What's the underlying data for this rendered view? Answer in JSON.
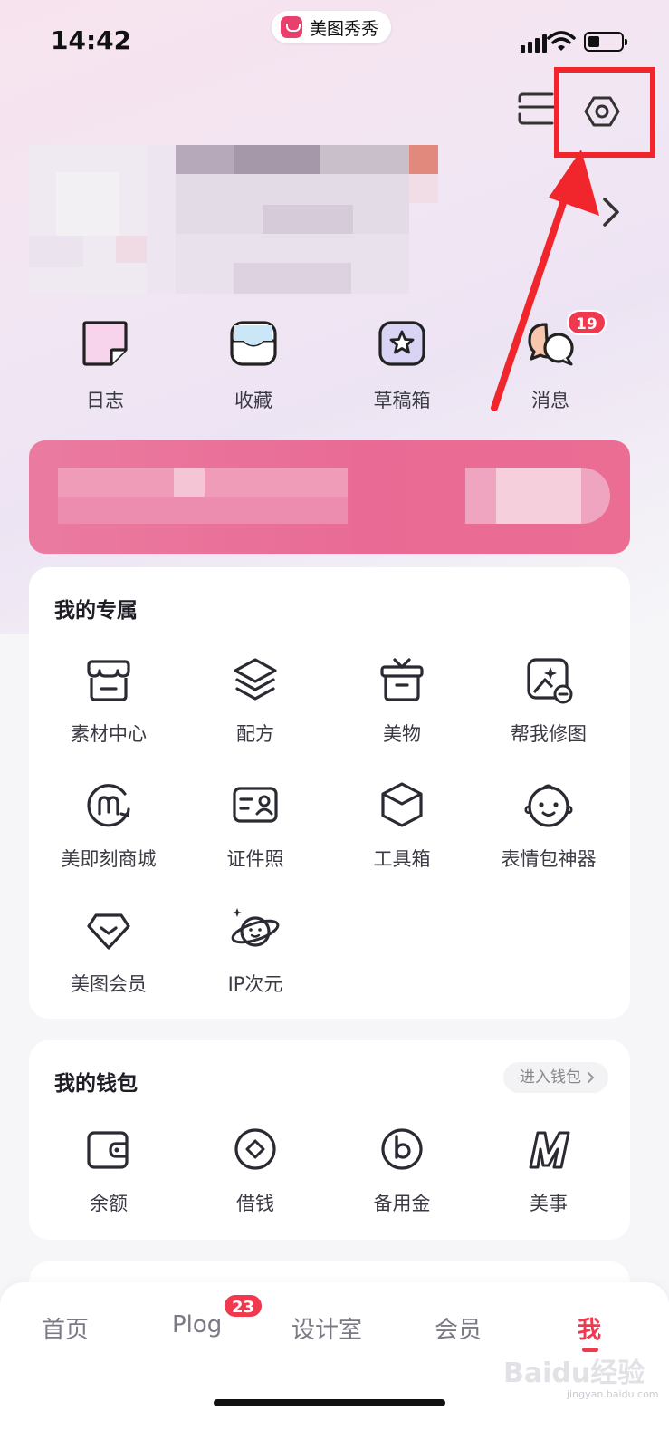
{
  "status_bar": {
    "time": "14:42",
    "app_name": "美图秀秀"
  },
  "header": {
    "scan_icon": "scan-icon",
    "settings_icon": "settings-hexagon-icon"
  },
  "quick_actions": [
    {
      "label": "日志",
      "icon": "diary-sticky-note-icon"
    },
    {
      "label": "收藏",
      "icon": "favorites-tray-icon"
    },
    {
      "label": "草稿箱",
      "icon": "drafts-star-icon"
    },
    {
      "label": "消息",
      "icon": "messages-chat-icon",
      "badge": "19"
    }
  ],
  "exclusive": {
    "title": "我的专属",
    "items": [
      {
        "label": "素材中心",
        "icon": "store-icon"
      },
      {
        "label": "配方",
        "icon": "layers-icon"
      },
      {
        "label": "美物",
        "icon": "gift-box-icon"
      },
      {
        "label": "帮我修图",
        "icon": "photo-edit-icon"
      },
      {
        "label": "美即刻商城",
        "icon": "mall-m-icon"
      },
      {
        "label": "证件照",
        "icon": "id-card-icon"
      },
      {
        "label": "工具箱",
        "icon": "toolbox-cube-icon"
      },
      {
        "label": "表情包神器",
        "icon": "baby-face-icon"
      },
      {
        "label": "美图会员",
        "icon": "diamond-icon"
      },
      {
        "label": "IP次元",
        "icon": "planet-icon"
      }
    ]
  },
  "wallet": {
    "title": "我的钱包",
    "link": "进入钱包",
    "items": [
      {
        "label": "余额",
        "icon": "wallet-icon"
      },
      {
        "label": "借钱",
        "icon": "coin-icon"
      },
      {
        "label": "备用金",
        "icon": "b-circle-icon"
      },
      {
        "label": "美事",
        "icon": "m-logo-icon"
      }
    ]
  },
  "tabbar": {
    "tabs": [
      {
        "label": "首页"
      },
      {
        "label": "Plog",
        "badge": "23"
      },
      {
        "label": "设计室"
      },
      {
        "label": "会员"
      },
      {
        "label": "我",
        "active": true
      }
    ]
  },
  "watermark": {
    "text": "Baidu经验",
    "sub": "jingyan.baidu.com"
  },
  "colors": {
    "accent": "#f0384f",
    "annotation_red": "#f0262c",
    "banner_pink": "#e96b95"
  }
}
